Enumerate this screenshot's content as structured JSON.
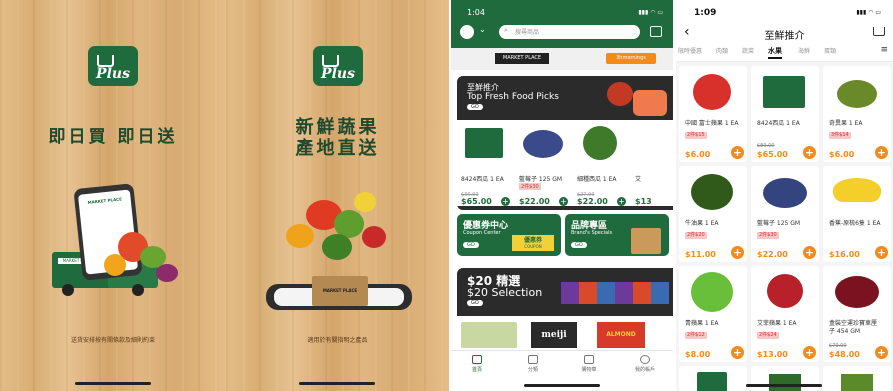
{
  "splash1": {
    "logo_text": "Plus",
    "slogan": "即日買 即日送",
    "phone_brand": "MARKET PLACE",
    "truck_brand": "MARKET PLACE",
    "caption": "送貨安排按有關條款及細則約束"
  },
  "splash2": {
    "logo_text": "Plus",
    "slogan_line1": "新鮮蔬果",
    "slogan_line2": "產地直送",
    "box_brand": "MARKET PLACE",
    "caption": "適用於有關指明之產品"
  },
  "home": {
    "status_time": "1:04",
    "search_placeholder": "搜尋商品",
    "stores": [
      "MARKET PLACE",
      "3hmornings"
    ],
    "fresh_section": {
      "title_zh": "至鮮推介",
      "title_en": "Top Fresh Food Picks",
      "go": "GO"
    },
    "fresh_products": [
      {
        "name": "8424西瓜 1 EA",
        "old_price": "$39.00",
        "price": "$65.00"
      },
      {
        "name": "藍莓子 125 GM",
        "promo": "2件$30",
        "price": "$22.00"
      },
      {
        "name": "細種西瓜 1 EA",
        "old_price": "$27.00",
        "price": "$22.00"
      },
      {
        "name": "艾",
        "price": "$13"
      }
    ],
    "coupon_card": {
      "title_zh": "優惠券中心",
      "title_en": "Coupon Center",
      "go": "GO",
      "badge_zh": "優惠券",
      "badge_en": "COUPON"
    },
    "brand_card": {
      "title_zh": "品牌專區",
      "title_en": "Brand's Specials",
      "go": "GO"
    },
    "selection_section": {
      "line1": "$20 精選",
      "line2": "$20 Selection",
      "go": "GO"
    },
    "selection_brands": [
      "meiji",
      "ALMOND"
    ],
    "tabs": [
      "首頁",
      "分類",
      "購物車",
      "我的帳戶"
    ]
  },
  "fresh": {
    "status_time": "1:09",
    "page_title": "至鮮推介",
    "categories": [
      "限時優惠",
      "肉類",
      "蔬菜",
      "水果",
      "海鮮",
      "蛋類"
    ],
    "active_category": "水果",
    "products": [
      {
        "name": "中國 富士蘋果 1 EA",
        "tag": "2件$15",
        "price": "$6.00"
      },
      {
        "name": "8424西瓜 1 EA",
        "old_price": "$89.00",
        "price": "$65.00"
      },
      {
        "name": "奇異果 1 EA",
        "tag": "3件$14",
        "price": "$6.00"
      },
      {
        "name": "牛油果 1 EA",
        "tag": "2件$20",
        "price": "$11.00"
      },
      {
        "name": "藍莓子 125 GM",
        "tag": "2件$30",
        "price": "$22.00"
      },
      {
        "name": "香蕉-原梳6隻 1 EA",
        "price": "$16.00"
      },
      {
        "name": "青蘋果 1 EA",
        "tag": "2件$12",
        "price": "$8.00"
      },
      {
        "name": "艾菲蘋果 1 EA",
        "tag": "2件$24",
        "price": "$13.00"
      },
      {
        "name": "盒裝空運珍寶車厘",
        "name2": "子 454 GM",
        "old_price": "$79.00",
        "price": "$48.00"
      }
    ]
  },
  "colors": {
    "brand_green": "#1f6b3d",
    "accent_orange": "#f28b1a",
    "dark_section": "#2b2b2b"
  }
}
